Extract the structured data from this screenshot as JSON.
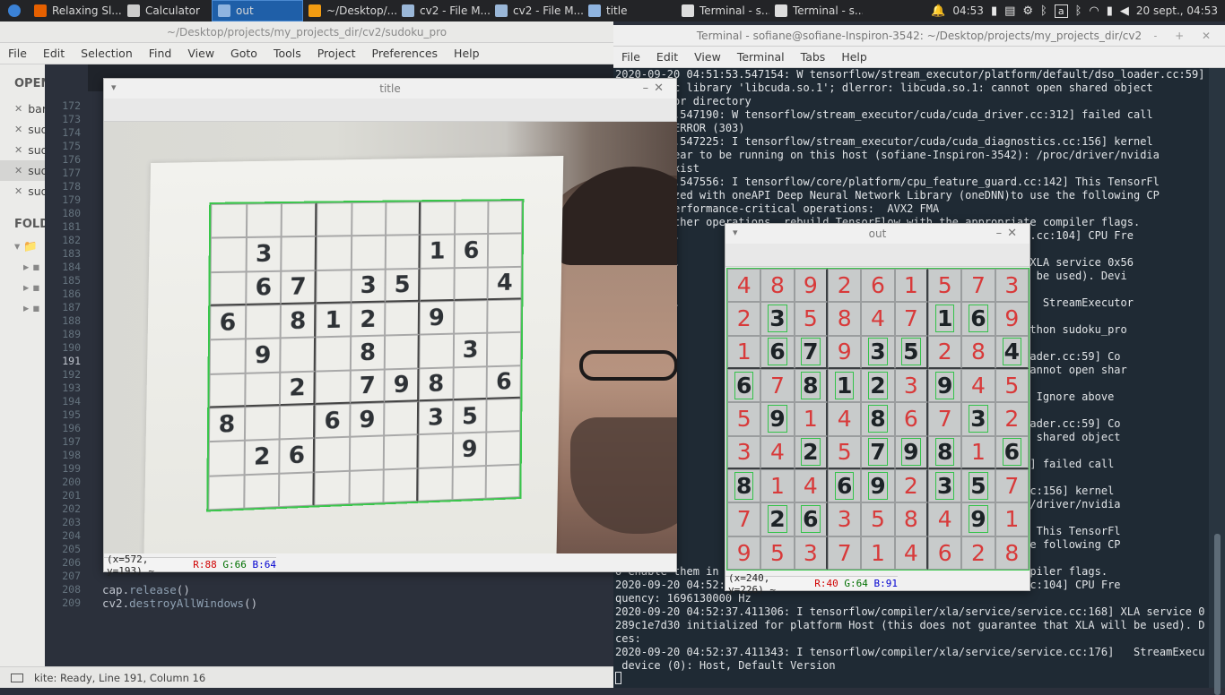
{
  "taskbar": {
    "items": [
      {
        "label": "Relaxing Sl...",
        "icon": "firefox-icon",
        "color": "#e66000"
      },
      {
        "label": "Calculator",
        "icon": "calculator-icon",
        "color": "#cccccc"
      },
      {
        "label": "out",
        "icon": "window-icon",
        "color": "#8fb4e0",
        "active": true
      },
      {
        "label": "~/Desktop/...",
        "icon": "sublime-icon",
        "color": "#f39c12"
      },
      {
        "label": "cv2 - File M...",
        "icon": "folder-icon",
        "color": "#9ab7d8"
      },
      {
        "label": "cv2 - File M...",
        "icon": "folder-icon",
        "color": "#9ab7d8"
      },
      {
        "label": "title",
        "icon": "window-icon",
        "color": "#8fb4e0"
      },
      {
        "label": "Terminal - s...",
        "icon": "terminal-icon",
        "color": "#dddddd"
      },
      {
        "label": "Terminal - s...",
        "icon": "terminal-icon",
        "color": "#dddddd"
      }
    ],
    "clock": "04:53",
    "date": "20 sept., 04:53"
  },
  "editor": {
    "title": "~/Desktop/projects/my_projects_dir/cv2/sudoku_pro",
    "menu": [
      "File",
      "Edit",
      "Selection",
      "Find",
      "View",
      "Goto",
      "Tools",
      "Project",
      "Preferences",
      "Help"
    ],
    "sidebar": {
      "open_header": "OPEN",
      "folders_header": "FOLD",
      "open_files": [
        "bar",
        "sud",
        "sud",
        "sud",
        "sud"
      ]
    },
    "line_numbers": [
      "172",
      "173",
      "174",
      "175",
      "176",
      "177",
      "178",
      "179",
      "180",
      "181",
      "182",
      "183",
      "184",
      "185",
      "186",
      "187",
      "188",
      "189",
      "190",
      "191",
      "192",
      "193",
      "194",
      "195",
      "196",
      "197",
      "198",
      "199",
      "200",
      "201",
      "202",
      "203",
      "204",
      "205",
      "206",
      "207",
      "208",
      "209"
    ],
    "code_lines": [
      {
        "line": "208",
        "obj": "cap",
        "fn": "release",
        "suffix": "()"
      },
      {
        "line": "209",
        "obj": "cv2",
        "fn": "destroyAllWindows",
        "suffix": "()"
      }
    ],
    "status": "kite: Ready, Line 191, Column 16"
  },
  "terminal": {
    "title": "Terminal - sofiane@sofiane-Inspiron-3542: ~/Desktop/projects/my_projects_dir/cv2",
    "menu": [
      "File",
      "Edit",
      "View",
      "Terminal",
      "Tabs",
      "Help"
    ],
    "lines": [
      "2020-09-20 04:51:53.547154: W tensorflow/stream_executor/platform/default/dso_loader.cc:59] Co",
      "ad dynamic library 'libcuda.so.1'; dlerror: libcuda.so.1: cannot open shared object",
      "uch file or directory",
      " 04:51:53.547190: W tensorflow/stream_executor/cuda/cuda_driver.cc:312] failed call",
      " UNKNOWN ERROR (303)",
      " 04:51:53.547225: I tensorflow/stream_executor/cuda/cuda_diagnostics.cc:156] kernel",
      "s not appear to be running on this host (sofiane-Inspiron-3542): /proc/driver/nvidia",
      "oes not exist",
      " 04:51:53.547556: I tensorflow/core/platform/cpu_feature_guard.cc:142] This TensorFl",
      "is optimized with oneAPI Deep Neural Network Library (oneDNN)to use the following CP",
      "ions in performance-critical operations:  AVX2 FMA",
      "them in other operations, rebuild TensorFlow with the appropriate compiler flags.",
      " 04:51:53.                                          ls/cpu_utils.cc:104] CPU Fre",
      "96130000",
      " 04:51:53.                                          ice.cc:168] XLA service 0x56",
      " initiali                                           hat XLA will be used). Devi",
      "",
      " 04:51:53.                                          ice.cc:176]   StreamExecutor",
      "): Host, ",
      "iane@sof                                           s_dir/cv2$ python sudoku_pro",
      "",
      " 04:52:                                           default/dso_loader.cc:59] Co",
      "ad dynam                                           rt.so.10.1: cannot open shar",
      " file: N",
      " 04:52:                                           rt_stub.cc:29] Ignore above",
      "rror if ",
      " 04:52:                                           default/dso_loader.cc:59] Co",
      "ad dynam                                           : cannot open shared object",
      "uch fil",
      " 04:52:                                           _driver.cc:312] failed call",
      " UNKNOWN",
      " 04:52:                                           _diagnostics.cc:156] kernel",
      "s not a                                           n-3542): /proc/driver/nvidia",
      "oes not",
      " 04:52:                                           _guard.cc:142] This TensorFl",
      "is opti                                           eDNN)to use the following CP",
      "ions in",
      "o enable them in                                  ppropriate compiler flags.",
      "2020-09-20 04:52:                                 ls/cpu_utils.cc:104] CPU Fre",
      "quency: 1696130000 Hz",
      "2020-09-20 04:52:37.411306: I tensorflow/compiler/xla/service/service.cc:168] XLA service 0x56",
      "289c1e7d30 initialized for platform Host (this does not guarantee that XLA will be used). Devi",
      "ces:",
      "2020-09-20 04:52:37.411343: I tensorflow/compiler/xla/service/service.cc:176]   StreamExecutor",
      " device (0): Host, Default Version"
    ]
  },
  "title_window": {
    "title": "title",
    "status": {
      "coords": "(x=572, y=193) ~",
      "r": "R:88",
      "g": "G:66",
      "b": "B:64"
    },
    "grid": [
      [
        "",
        "",
        "",
        "",
        "",
        "",
        "",
        "",
        ""
      ],
      [
        "",
        "3",
        "",
        "",
        "",
        "",
        "1",
        "6",
        ""
      ],
      [
        "",
        "6",
        "7",
        "",
        "3",
        "5",
        "",
        "",
        "4"
      ],
      [
        "6",
        "",
        "8",
        "1",
        "2",
        "",
        "9",
        "",
        ""
      ],
      [
        "",
        "9",
        "",
        "",
        "8",
        "",
        "",
        "3",
        ""
      ],
      [
        "",
        "",
        "2",
        "",
        "7",
        "9",
        "8",
        "",
        "6"
      ],
      [
        "8",
        "",
        "",
        "6",
        "9",
        "",
        "3",
        "5",
        ""
      ],
      [
        "",
        "2",
        "6",
        "",
        "",
        "",
        "",
        "9",
        ""
      ],
      [
        "",
        "",
        "",
        "",
        "",
        "",
        "",
        "",
        ""
      ]
    ]
  },
  "out_window": {
    "title": "out",
    "status": {
      "coords": "(x=240, y=226) ~",
      "r": "R:40",
      "g": "G:64",
      "b": "B:91"
    },
    "solution": [
      [
        "4",
        "8",
        "9",
        "2",
        "6",
        "1",
        "5",
        "7",
        "3"
      ],
      [
        "2",
        "3",
        "5",
        "8",
        "4",
        "7",
        "1",
        "6",
        "9"
      ],
      [
        "1",
        "6",
        "7",
        "9",
        "3",
        "5",
        "2",
        "8",
        "4"
      ],
      [
        "6",
        "7",
        "8",
        "1",
        "2",
        "3",
        "9",
        "4",
        "5"
      ],
      [
        "5",
        "9",
        "1",
        "4",
        "8",
        "6",
        "7",
        "3",
        "2"
      ],
      [
        "3",
        "4",
        "2",
        "5",
        "7",
        "9",
        "8",
        "1",
        "6"
      ],
      [
        "8",
        "1",
        "4",
        "6",
        "9",
        "2",
        "3",
        "5",
        "7"
      ],
      [
        "7",
        "2",
        "6",
        "3",
        "5",
        "8",
        "4",
        "9",
        "1"
      ],
      [
        "9",
        "5",
        "3",
        "7",
        "1",
        "4",
        "6",
        "2",
        "8"
      ]
    ]
  }
}
